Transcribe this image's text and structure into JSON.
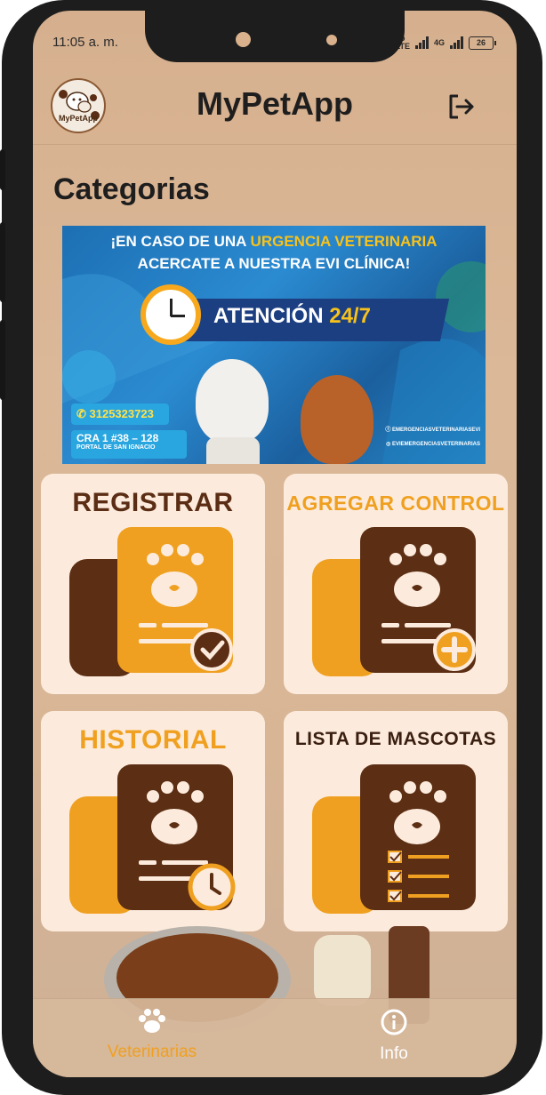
{
  "status_bar": {
    "time": "11:05 a. m.",
    "network_vo": "Vo",
    "network_lte": "LTE",
    "network_4g": "4G",
    "battery": "26"
  },
  "app_bar": {
    "logo_text": "MyPetApp",
    "title": "MyPetApp",
    "logout_icon": "logout-icon"
  },
  "section": {
    "title": "Categorias"
  },
  "banner": {
    "line1_prefix": "¡EN CASO DE UNA ",
    "line1_highlight": "URGENCIA VETERINARIA",
    "line2": "ACERCATE A NUESTRA EVI CLÍNICA!",
    "attention_label": "ATENCIÓN ",
    "attention_hours": "24/7",
    "phone": "3125323723",
    "address": "CRA 1 #38 – 128",
    "address_sub": "PORTAL DE SAN IGNACIO",
    "facebook": "EMERGENCIASVETERINARIASEVI",
    "instagram": "EVIEMERGENCIASVETERINARIAS"
  },
  "categories": [
    {
      "title": "REGISTRAR",
      "icon": "register-paw-check-icon",
      "title_color": "#5a2d14"
    },
    {
      "title": "AGREGAR CONTROL",
      "icon": "add-control-paw-plus-icon",
      "title_color": "#f0a020"
    },
    {
      "title": "HISTORIAL",
      "icon": "history-paw-clock-icon",
      "title_color": "#f0a020"
    },
    {
      "title": "LISTA DE MASCOTAS",
      "icon": "pet-list-paw-checklist-icon",
      "title_color": "#3a1f10"
    }
  ],
  "bottom_nav": {
    "items": [
      {
        "label": "Veterinarias",
        "icon": "paw-icon",
        "active": true
      },
      {
        "label": "Info",
        "icon": "info-icon",
        "active": false
      }
    ]
  },
  "colors": {
    "accent": "#f0a020",
    "brown": "#5c2e14",
    "card_bg": "#fcebdc"
  }
}
